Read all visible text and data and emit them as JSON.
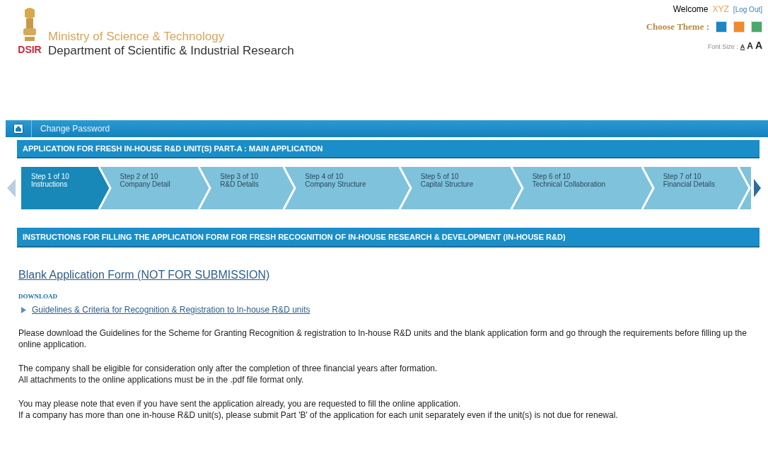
{
  "header": {
    "logo_text": "DSIR",
    "ministry": "Ministry of Science & Technology",
    "department": "Department of Scientific & Industrial Research",
    "welcome": {
      "label": "Welcome",
      "user": "XYZ",
      "logout": "[Log Out]"
    },
    "theme": {
      "label": "Choose Theme :",
      "options": [
        {
          "color": "#1a86c4",
          "selected": false
        },
        {
          "color": "#f08a2c",
          "selected": false
        },
        {
          "color": "#4aa86a",
          "selected": false
        }
      ]
    },
    "font_size": {
      "label": "Font Size :",
      "options": [
        "A",
        "A",
        "A"
      ]
    }
  },
  "nav": {
    "items": [
      "Change Password"
    ]
  },
  "form_title": "APPLICATION FOR FRESH IN-HOUSE R&D UNIT(S) PART-A : MAIN APPLICATION",
  "steps": [
    {
      "step": "Step 1 of 10",
      "name": "Instructions",
      "selected": true
    },
    {
      "step": "Step 2 of 10",
      "name": "Company Detail",
      "selected": false
    },
    {
      "step": "Step 3 of 10",
      "name": "R&D Details",
      "selected": false
    },
    {
      "step": "Step 4 of 10",
      "name": "Company Structure",
      "selected": false
    },
    {
      "step": "Step 5 of 10",
      "name": "Capital Structure",
      "selected": false
    },
    {
      "step": "Step 6 of 10",
      "name": "Technical Collaboration",
      "selected": false
    },
    {
      "step": "Step 7 of 10",
      "name": "Financial Details",
      "selected": false
    }
  ],
  "section_title": "INSTRUCTIONS FOR FILLING THE APPLICATION FORM FOR FRESH RECOGNITION OF IN-HOUSE RESEARCH & DEVELOPMENT (IN-HOUSE R&D)",
  "blank_form_link": "Blank Application Form (NOT FOR SUBMISSION)",
  "download": {
    "label": "DOWNLOAD",
    "links": [
      "Guidelines & Criteria for Recognition & Registration to In-house R&D units"
    ]
  },
  "paragraphs": [
    [
      "Please download the Guidelines for the Scheme for Granting Recognition & registration to In-house R&D units and the blank application form and go through the requirements before filling up the online application."
    ],
    [
      "The company shall be eligible for consideration only after the completion of three financial years after formation.",
      "All attachments to the online applications must be in the .pdf file format only."
    ],
    [
      "You may please note that even if you have sent the application already, you are requested to fill the online application.",
      "If a company has more than one in-house R&D unit(s), please submit Part 'B' of the application for each unit separately even if the unit(s) is not due for renewal."
    ]
  ]
}
